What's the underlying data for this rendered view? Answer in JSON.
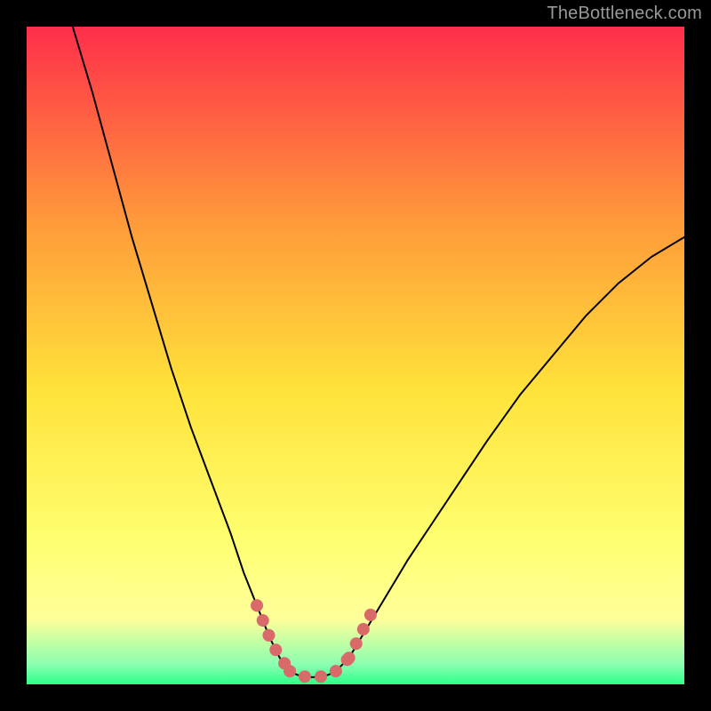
{
  "watermark": "TheBottleneck.com",
  "chart_data": {
    "type": "line",
    "title": "",
    "xlabel": "",
    "ylabel": "",
    "xlim": [
      0,
      100
    ],
    "ylim": [
      0,
      100
    ],
    "background_gradient": {
      "top": "#ff2e4a",
      "mid_upper": "#ff9b3a",
      "mid": "#ffe23a",
      "lower": "#ffff9a",
      "bottom": "#2cff8a"
    },
    "series": [
      {
        "name": "left-curve",
        "color": "#000000",
        "x": [
          7,
          10,
          13,
          16,
          19,
          22,
          25,
          28,
          31,
          33,
          35,
          37,
          38.5,
          40
        ],
        "y": [
          100,
          90,
          79,
          68,
          58,
          48,
          39,
          31,
          23,
          17,
          12,
          7,
          4,
          2
        ]
      },
      {
        "name": "valley-floor",
        "color": "#000000",
        "x": [
          40,
          41,
          42,
          43,
          44,
          45,
          46,
          47,
          48,
          49
        ],
        "y": [
          2,
          1.5,
          1.2,
          1.1,
          1.1,
          1.2,
          1.5,
          2,
          3,
          4
        ]
      },
      {
        "name": "right-curve",
        "color": "#000000",
        "x": [
          49,
          52,
          55,
          58,
          62,
          66,
          70,
          75,
          80,
          85,
          90,
          95,
          100
        ],
        "y": [
          4,
          9,
          14,
          19,
          25,
          31,
          37,
          44,
          50,
          56,
          61,
          65,
          68
        ]
      },
      {
        "name": "highlight-left-descent",
        "color": "#d86a6a",
        "stroke_width": 14,
        "x": [
          35,
          36,
          37,
          38,
          39,
          40
        ],
        "y": [
          12,
          9.5,
          7,
          5,
          3.5,
          2
        ]
      },
      {
        "name": "highlight-valley-floor",
        "color": "#d86a6a",
        "stroke_width": 14,
        "x": [
          40,
          41,
          42,
          43,
          44,
          45,
          46,
          47,
          48,
          49
        ],
        "y": [
          2,
          1.5,
          1.2,
          1.1,
          1.1,
          1.2,
          1.5,
          2,
          3,
          4
        ]
      },
      {
        "name": "highlight-right-ascent",
        "color": "#d86a6a",
        "stroke_width": 14,
        "x": [
          49,
          50,
          51,
          52,
          53
        ],
        "y": [
          4,
          6,
          8,
          10,
          12
        ]
      }
    ]
  }
}
